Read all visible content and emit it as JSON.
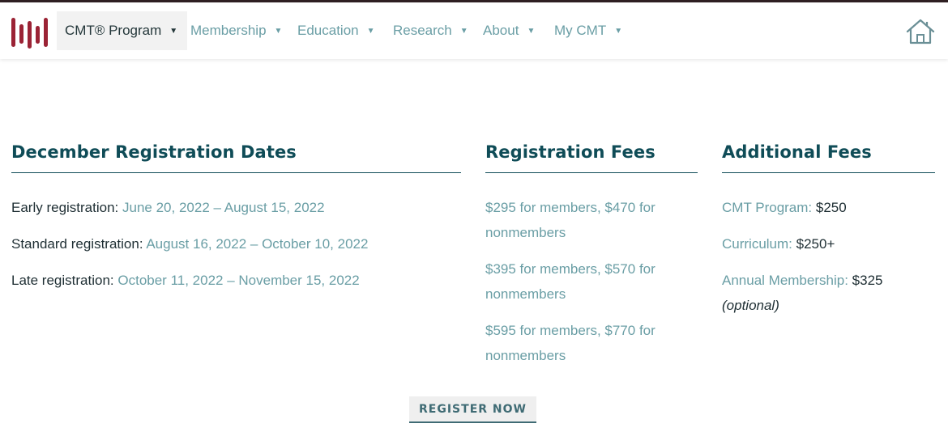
{
  "nav": {
    "logo_alt": "CMT logo",
    "items": [
      {
        "label": "CMT® Program"
      },
      {
        "label": "Membership"
      },
      {
        "label": "Education"
      },
      {
        "label": "Research"
      },
      {
        "label": "About"
      },
      {
        "label": "My CMT"
      }
    ],
    "home_icon": "home-icon"
  },
  "dates": {
    "title": "December Registration Dates",
    "rows": [
      {
        "label": "Early registration:",
        "value": "June 20, 2022 – August 15, 2022"
      },
      {
        "label": "Standard registration:",
        "value": "August 16, 2022 – October 10, 2022"
      },
      {
        "label": "Late registration:",
        "value": "October 11, 2022 – November 15, 2022"
      }
    ]
  },
  "fees": {
    "title": "Registration Fees",
    "items": [
      {
        "line1": "$295 for members, $470 for",
        "line2": "nonmembers"
      },
      {
        "line1": "$395 for members, $570 for",
        "line2": "nonmembers"
      },
      {
        "line1": "$595 for members, $770 for",
        "line2": "nonmembers"
      }
    ]
  },
  "additional": {
    "title": "Additional Fees",
    "rows": [
      {
        "label": "CMT Program:",
        "value": "$250"
      },
      {
        "label": "Curriculum:",
        "value": "$250+"
      },
      {
        "label": "Annual Membership:",
        "value": "$325",
        "note": "(optional)"
      }
    ]
  },
  "cta": {
    "label": "REGISTER NOW"
  },
  "colors": {
    "brand_red": "#9b2335",
    "heading_teal": "#0f4c57",
    "link_teal": "#6a9ea5",
    "text_dark": "#1e2e33"
  }
}
